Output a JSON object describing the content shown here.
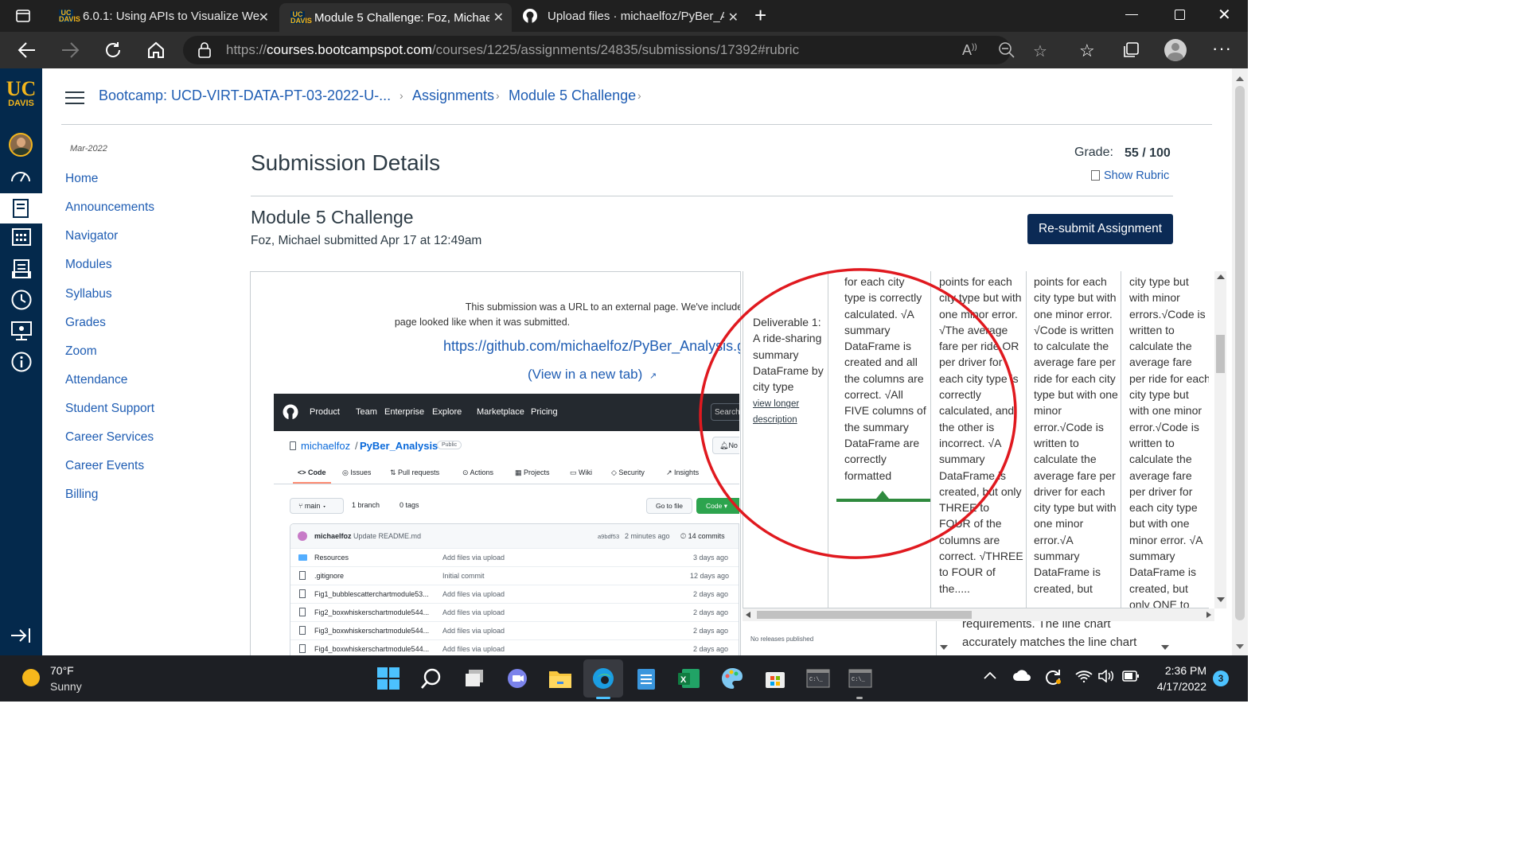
{
  "browser": {
    "tabs": [
      {
        "label": "6.0.1: Using APIs to Visualize We",
        "favicon": "uc-davis-logo"
      },
      {
        "label": "Module 5 Challenge: Foz, Michae",
        "favicon": "uc-davis-logo",
        "active": true
      },
      {
        "label": "Upload files · michaelfoz/PyBer_A",
        "favicon": "github-icon"
      }
    ],
    "url_prefix": "https://",
    "url_domain": "courses.bootcampspot.com",
    "url_path": "/courses/1225/assignments/24835/submissions/17392#rubric"
  },
  "canvas": {
    "logo_top": "UC",
    "logo_bottom": "DAVIS",
    "breadcrumb": [
      "Bootcamp: UCD-VIRT-DATA-PT-03-2022-U-...",
      "Assignments",
      "Module 5 Challenge"
    ],
    "term": "Mar-2022",
    "nav": [
      "Home",
      "Announcements",
      "Navigator",
      "Modules",
      "Syllabus",
      "Grades",
      "Zoom",
      "Attendance",
      "Student Support",
      "Career Services",
      "Career Events",
      "Billing"
    ]
  },
  "submission": {
    "title": "Submission Details",
    "grade_label": "Grade:",
    "grade_value": "55 / 100",
    "show_rubric": "Show Rubric",
    "assignment_title": "Module 5 Challenge",
    "submitted_by": "Foz, Michael submitted Apr 17 at 12:49am",
    "resubmit": "Re-submit Assignment",
    "snapshot_note_1": "This submission was a URL to an external page. We've included a snapshot o",
    "snapshot_note_2": "page looked like when it was submitted.",
    "external_url": "https://github.com/michaelfoz/PyBer_Analysis.gi",
    "view_new_tab": "(View in a new tab)"
  },
  "github": {
    "nav": [
      "Product",
      "Team",
      "Enterprise",
      "Explore",
      "Marketplace",
      "Pricing"
    ],
    "search": "Search",
    "notif": "No",
    "owner": "michaelfoz",
    "repo": "PyBer_Analysis",
    "visibility": "Public",
    "tabs": [
      "Code",
      "Issues",
      "Pull requests",
      "Actions",
      "Projects",
      "Wiki",
      "Security",
      "Insights"
    ],
    "branch": "main",
    "branches": "1 branch",
    "tags": "0 tags",
    "go_to_file": "Go to file",
    "code_btn": "Code",
    "commit_author": "michaelfoz",
    "commit_msg": "Update README.md",
    "commit_hash": "a9bdf53",
    "commit_time": "2 minutes ago",
    "commits": "14 commits",
    "files": [
      {
        "name": "Resources",
        "msg": "Add files via upload",
        "time": "3 days ago",
        "type": "folder"
      },
      {
        "name": ".gitignore",
        "msg": "Initial commit",
        "time": "12 days ago",
        "type": "file"
      },
      {
        "name": "Fig1_bubblescatterchartmodule53...",
        "msg": "Add files via upload",
        "time": "2 days ago",
        "type": "file"
      },
      {
        "name": "Fig2_boxwhiskerschartmodule544...",
        "msg": "Add files via upload",
        "time": "2 days ago",
        "type": "file"
      },
      {
        "name": "Fig3_boxwhiskerschartmodule544...",
        "msg": "Add files via upload",
        "time": "2 days ago",
        "type": "file"
      },
      {
        "name": "Fig4_boxwhiskerschartmodule544...",
        "msg": "Add files via upload",
        "time": "2 days ago",
        "type": "file"
      }
    ],
    "no_releases": "No releases published"
  },
  "rubric": {
    "criterion": "Deliverable 1: A ride-sharing summary DataFrame by city type",
    "view_longer": "view longer description",
    "col1": "for each city type is correctly calculated. √A summary DataFrame is created and all the columns are correct. √All FIVE columns of the summary DataFrame are correctly formatted",
    "col2": "points for each city type but with one minor error. √The average fare per ride OR per driver for each city type is correctly calculated, and the other is incorrect. √A summary DataFrame is created, but only THREE to FOUR of the columns are correct. √THREE to FOUR of the.....",
    "col3": "points for each city type but with one minor error. √Code is written to calculate the average fare per ride for each city type but with one minor error.√Code is written to calculate the average fare per driver for each city type but with one minor error.√A summary DataFrame is created, but",
    "col4": "city type but with minor errors.√Code is written to calculate the average fare per ride for each city type but with one minor error.√Code is written to calculate the average fare per driver for each city type but with one minor error. √A summary DataFrame is created, but only ONE to",
    "behind_1": "requirements. The line chart",
    "behind_2": "accurately matches the line chart"
  },
  "taskbar": {
    "temp": "70°F",
    "weather": "Sunny",
    "time": "2:36 PM",
    "date": "4/17/2022",
    "badge": "3"
  },
  "colors": {
    "canvas_nav": "#04294c",
    "uc_gold": "#f2b51c",
    "link": "#1f5db3",
    "resubmit_bg": "#0b2a55",
    "annotation": "#e0191f",
    "rubric_selected": "#2f8a3e"
  }
}
